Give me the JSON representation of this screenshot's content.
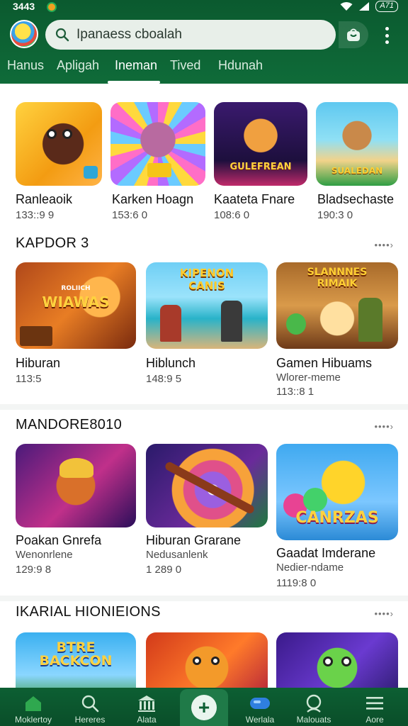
{
  "status_bar": {
    "time": "3443",
    "battery_label": "A71"
  },
  "search": {
    "value": "Ipanaess cboalah"
  },
  "tabs": [
    {
      "label": "Hanus",
      "active": false
    },
    {
      "label": "Apligah",
      "active": false
    },
    {
      "label": "Ineman",
      "active": true
    },
    {
      "label": "Tived",
      "active": false
    },
    {
      "label": "Hdunah",
      "active": false
    }
  ],
  "row1": [
    {
      "title": "Ranleaoik",
      "meta": "133::9 9"
    },
    {
      "title": "Karken Hoagn",
      "meta": "153:6 0"
    },
    {
      "title": "Kaateta Fnare",
      "meta": "108:6 0",
      "art_text": "GULEFREAN"
    },
    {
      "title": "Bladsechaste",
      "meta": "190:3 0",
      "art_text": "SUALEDAN"
    }
  ],
  "section2": {
    "title": "KAPDOR 3",
    "more": "••••›",
    "items": [
      {
        "title": "Hiburan",
        "meta": "113:5",
        "art_text_small": "ROLIICH",
        "art_text": "WIAWAS"
      },
      {
        "title": "Hiblunch",
        "meta": "148:9 5",
        "art_text": "KIPENON CANIS"
      },
      {
        "title": "Gamen Hibuams",
        "sub": "Wlorer-meme",
        "meta": "113::8 1",
        "art_text": "SLANNNES RIMAIK"
      }
    ]
  },
  "section3": {
    "title": "MANDORE8010",
    "more": "••••›",
    "items": [
      {
        "title": "Poakan Gnrefa",
        "sub": "Wenonrlene",
        "meta": "129:9 8"
      },
      {
        "title": "Hiburan Grarane",
        "sub": "Nedusanlenk",
        "meta": "1 289 0"
      },
      {
        "title": "Gaadat Imderane",
        "sub": "Nedier-ndame",
        "meta": "1119:8 0",
        "art_text": "CANRZAS"
      }
    ]
  },
  "section4": {
    "title": "IKARIAL HIONIEIONS",
    "more": "••••›",
    "items": [
      {
        "art_text": "BTRE BACKCON"
      },
      {
        "art_text": ""
      },
      {
        "art_text": ""
      }
    ]
  },
  "bottom_nav": [
    {
      "label": "Moklertoy",
      "icon": "home-icon"
    },
    {
      "label": "Hereres",
      "icon": "search-icon"
    },
    {
      "label": "Alata",
      "icon": "library-icon"
    },
    {
      "label": "",
      "icon": "plus-icon"
    },
    {
      "label": "Werlala",
      "icon": "controller-icon"
    },
    {
      "label": "Malouats",
      "icon": "profile-icon"
    },
    {
      "label": "Aore",
      "icon": "menu-icon"
    }
  ],
  "colors": {
    "header_green": "#0f6b39",
    "nav_green": "#0d5f33",
    "accent": "#1f7a48"
  }
}
